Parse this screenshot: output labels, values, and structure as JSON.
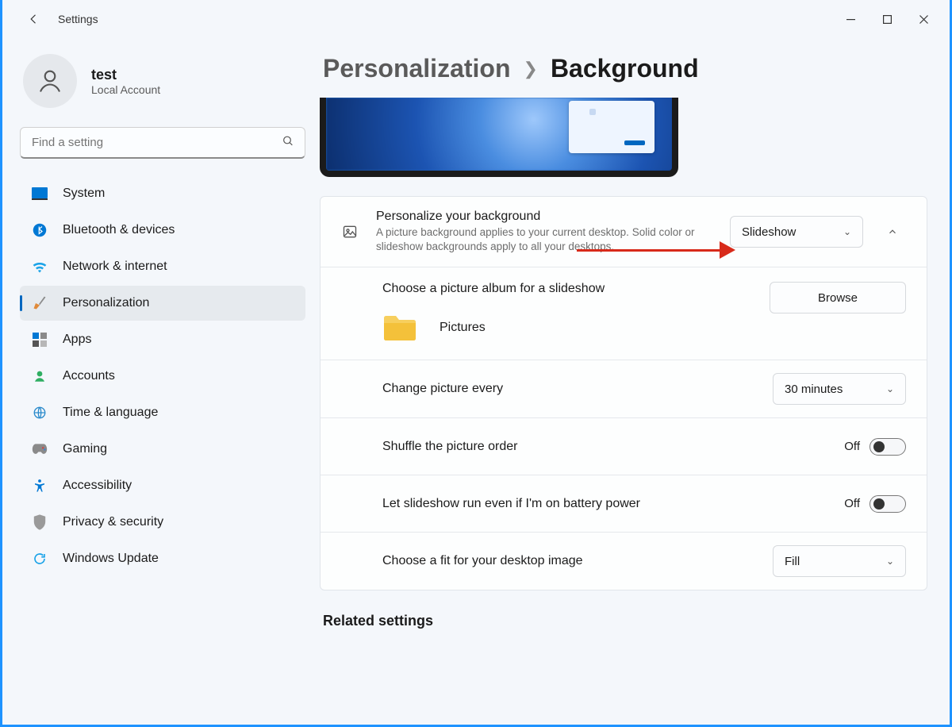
{
  "app": {
    "name": "Settings"
  },
  "account": {
    "name": "test",
    "type": "Local Account"
  },
  "search": {
    "placeholder": "Find a setting"
  },
  "nav": {
    "items": [
      {
        "label": "System"
      },
      {
        "label": "Bluetooth & devices"
      },
      {
        "label": "Network & internet"
      },
      {
        "label": "Personalization"
      },
      {
        "label": "Apps"
      },
      {
        "label": "Accounts"
      },
      {
        "label": "Time & language"
      },
      {
        "label": "Gaming"
      },
      {
        "label": "Accessibility"
      },
      {
        "label": "Privacy & security"
      },
      {
        "label": "Windows Update"
      }
    ],
    "selected_index": 3
  },
  "breadcrumb": {
    "parent": "Personalization",
    "current": "Background"
  },
  "personalize": {
    "title": "Personalize your background",
    "desc": "A picture background applies to your current desktop. Solid color or slideshow backgrounds apply to all your desktops.",
    "value": "Slideshow"
  },
  "album": {
    "title": "Choose a picture album for a slideshow",
    "browse": "Browse",
    "folder": "Pictures"
  },
  "change_every": {
    "title": "Change picture every",
    "value": "30 minutes"
  },
  "shuffle": {
    "title": "Shuffle the picture order",
    "state": "Off"
  },
  "battery": {
    "title": "Let slideshow run even if I'm on battery power",
    "state": "Off"
  },
  "fit": {
    "title": "Choose a fit for your desktop image",
    "value": "Fill"
  },
  "related": {
    "heading": "Related settings"
  }
}
